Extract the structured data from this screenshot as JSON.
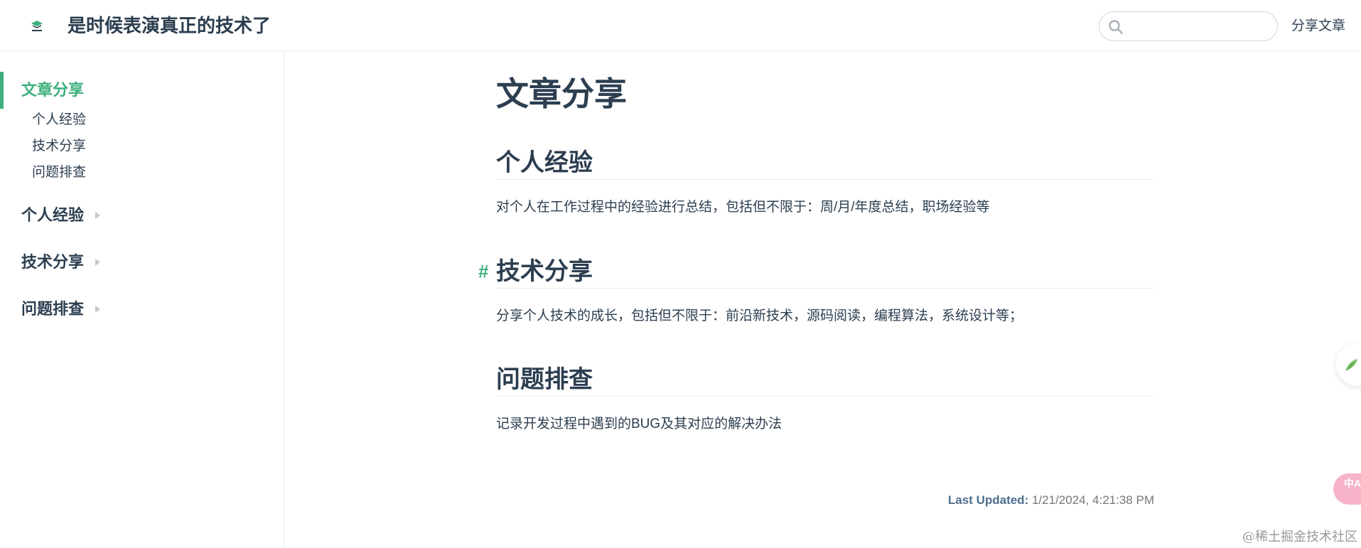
{
  "navbar": {
    "logo_icon": "site-logo-icon",
    "title": "是时候表演真正的技术了",
    "search": {
      "value": "",
      "placeholder": ""
    },
    "links": [
      {
        "label": "分享文章"
      }
    ]
  },
  "sidebar": {
    "active_group": {
      "label": "文章分享",
      "items": [
        {
          "label": "个人经验"
        },
        {
          "label": "技术分享"
        },
        {
          "label": "问题排查"
        }
      ]
    },
    "groups": [
      {
        "label": "个人经验"
      },
      {
        "label": "技术分享"
      },
      {
        "label": "问题排查"
      }
    ]
  },
  "main": {
    "title": "文章分享",
    "sections": [
      {
        "heading": "个人经验",
        "text": "对个人在工作过程中的经验进行总结，包括但不限于：周/月/年度总结，职场经验等"
      },
      {
        "heading": "技术分享",
        "text": "分享个人技术的成长，包括但不限于：前沿新技术，源码阅读，编程算法，系统设计等；"
      },
      {
        "heading": "问题排查",
        "text": "记录开发过程中遇到的BUG及其对应的解决办法"
      }
    ],
    "hash_symbol": "#",
    "last_updated_label": "Last Updated:",
    "last_updated_value": "1/21/2024, 4:21:38 PM"
  },
  "floating": {
    "theme_icon": "feather-icon",
    "translate_icon": "translate-icon",
    "translate_glyphs": "中A"
  },
  "watermark": "@稀土掘金技术社区",
  "colors": {
    "accent": "#3eaf7c",
    "text": "#2c3e50",
    "border": "#eaecef",
    "muted": "#767676"
  }
}
